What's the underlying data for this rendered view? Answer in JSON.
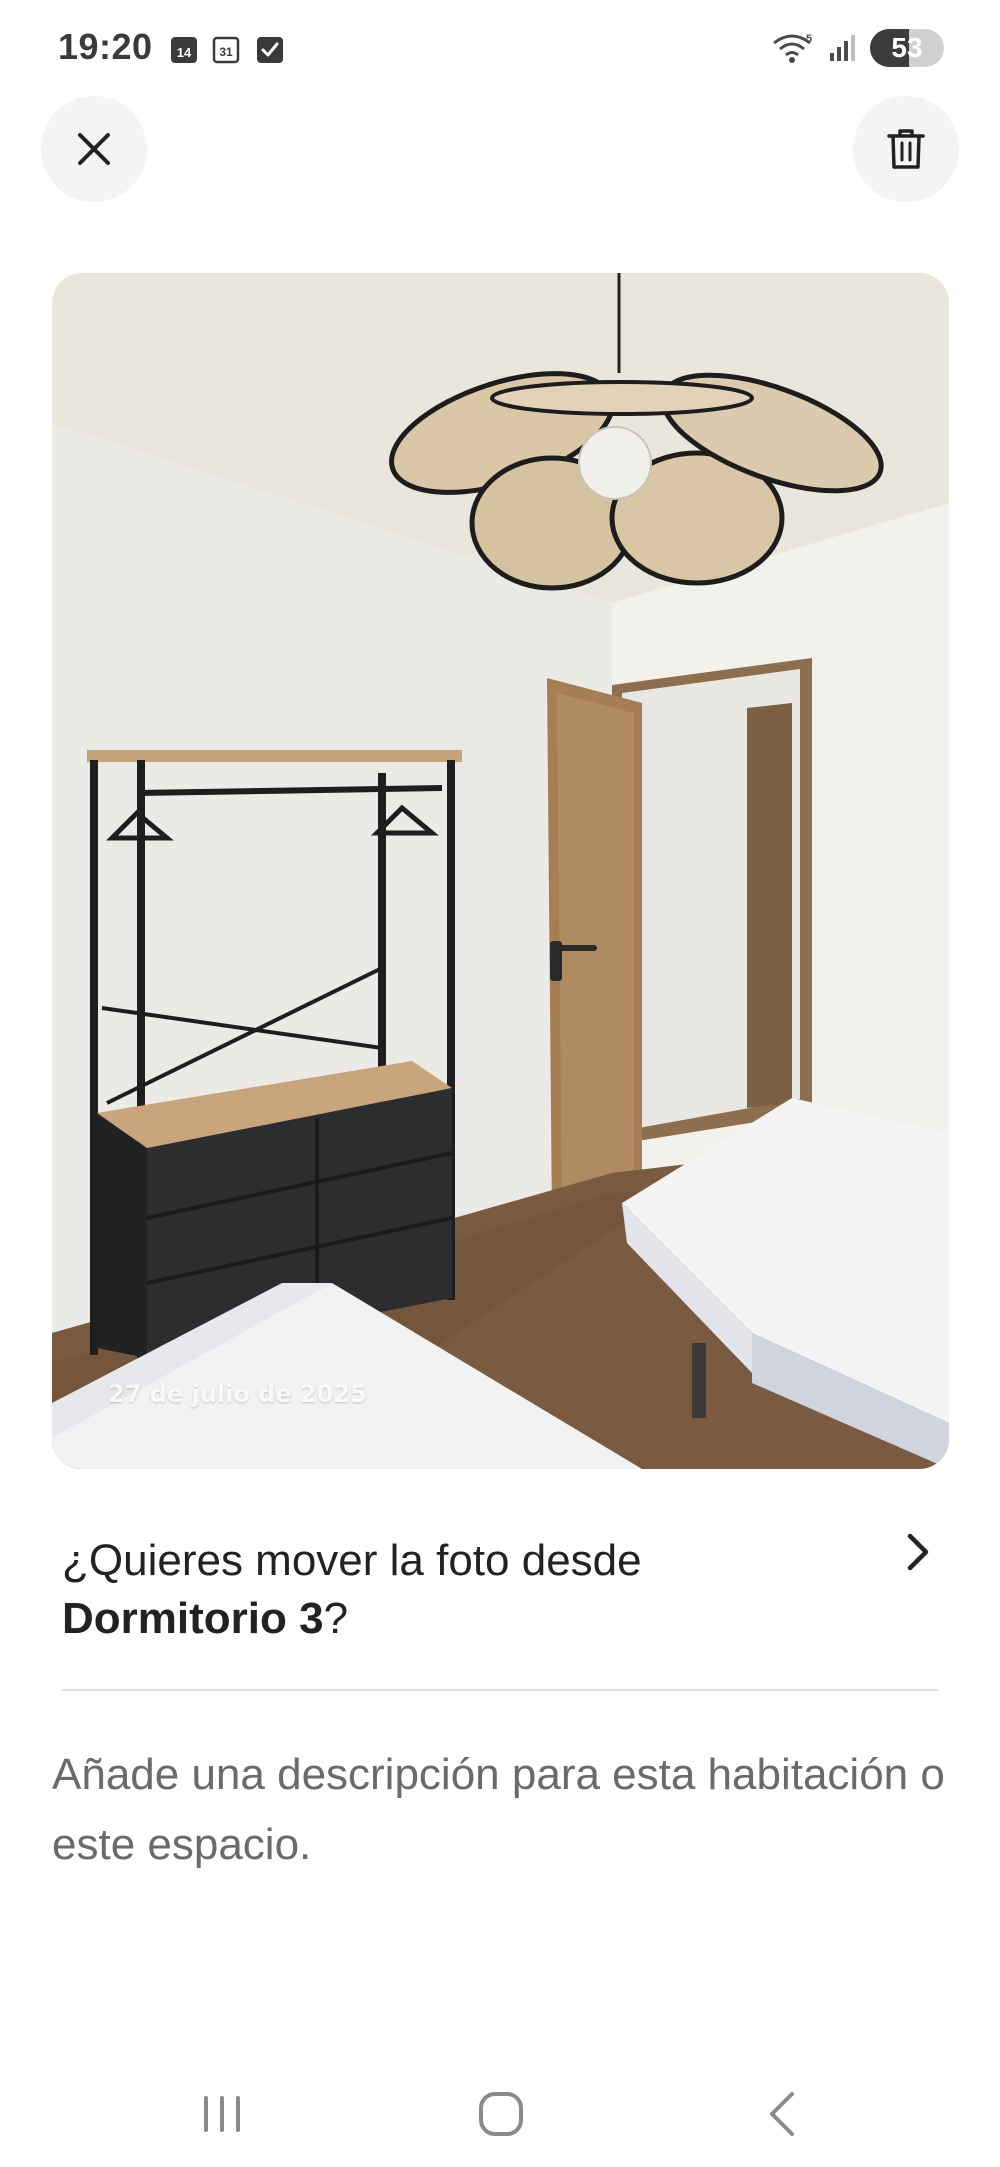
{
  "status_bar": {
    "time": "19:20",
    "notification_icons": [
      "calendar-14-icon",
      "calendar-31-icon",
      "checkbox-icon"
    ],
    "calendar_a": "14",
    "calendar_b": "31",
    "system_icons": [
      "wifi-icon",
      "signal-icon",
      "battery-icon"
    ],
    "wifi_band": "5",
    "battery_level": "53"
  },
  "header": {
    "close_icon": "close-icon",
    "delete_icon": "trash-icon"
  },
  "photo": {
    "date_label": "27 de julio de 2025"
  },
  "move_prompt": {
    "prefix": "¿Quieres mover la foto desde",
    "room": "Dormitorio 3",
    "suffix": "?"
  },
  "description": {
    "placeholder": "Añade una descripción para esta habitación o este espacio."
  },
  "nav_bar": {
    "buttons": [
      "recents-icon",
      "home-icon",
      "back-icon"
    ]
  },
  "colors": {
    "text": "#222222",
    "muted": "#6a6a6a",
    "button_bg": "#f4f4f4",
    "divider": "#dddddd"
  }
}
